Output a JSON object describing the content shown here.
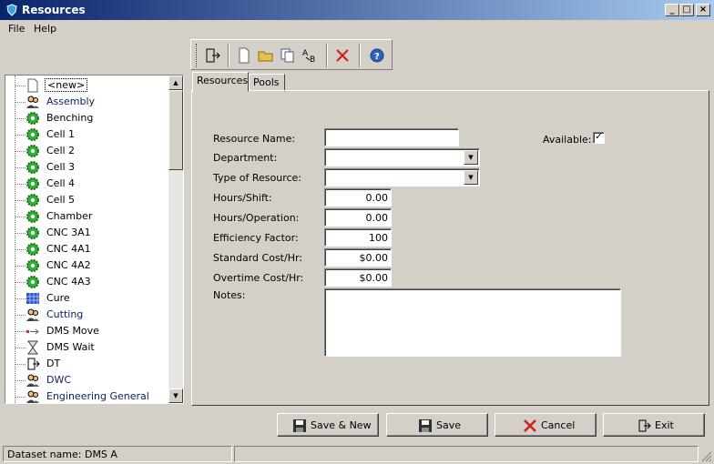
{
  "window": {
    "title": "Resources"
  },
  "menu": {
    "file": "File",
    "help": "Help"
  },
  "tree": {
    "items": [
      {
        "label": "<new>",
        "icon": "document-icon",
        "blue": false,
        "selected": true
      },
      {
        "label": "Assembly",
        "icon": "people-icon",
        "blue": true
      },
      {
        "label": "Benching",
        "icon": "gear-icon",
        "blue": false
      },
      {
        "label": "Cell 1",
        "icon": "gear-icon",
        "blue": false
      },
      {
        "label": "Cell 2",
        "icon": "gear-icon",
        "blue": false
      },
      {
        "label": "Cell 3",
        "icon": "gear-icon",
        "blue": false
      },
      {
        "label": "Cell 4",
        "icon": "gear-icon",
        "blue": false
      },
      {
        "label": "Cell 5",
        "icon": "gear-icon",
        "blue": false
      },
      {
        "label": "Chamber",
        "icon": "gear-icon",
        "blue": false
      },
      {
        "label": "CNC 3A1",
        "icon": "gear-icon",
        "blue": false
      },
      {
        "label": "CNC 4A1",
        "icon": "gear-icon",
        "blue": false
      },
      {
        "label": "CNC 4A2",
        "icon": "gear-icon",
        "blue": false
      },
      {
        "label": "CNC 4A3",
        "icon": "gear-icon",
        "blue": false
      },
      {
        "label": "Cure",
        "icon": "grid-icon",
        "blue": false
      },
      {
        "label": "Cutting",
        "icon": "people-icon",
        "blue": true
      },
      {
        "label": "DMS Move",
        "icon": "move-arrow-icon",
        "blue": false
      },
      {
        "label": "DMS Wait",
        "icon": "hourglass-icon",
        "blue": false
      },
      {
        "label": "DT",
        "icon": "door-exit-icon",
        "blue": false
      },
      {
        "label": "DWC",
        "icon": "people-icon",
        "blue": true
      },
      {
        "label": "Engineering General",
        "icon": "people-icon",
        "blue": true
      }
    ]
  },
  "tabs": [
    {
      "label": "Resources",
      "active": true
    },
    {
      "label": "Pools",
      "active": false
    }
  ],
  "form": {
    "resource_name": {
      "label": "Resource Name:",
      "value": ""
    },
    "available": {
      "label": "Available:",
      "checked": true,
      "mark": "✓"
    },
    "department": {
      "label": "Department:",
      "value": ""
    },
    "type_of_resource": {
      "label": "Type of Resource:",
      "value": ""
    },
    "hours_shift": {
      "label": "Hours/Shift:",
      "value": "0.00"
    },
    "hours_operation": {
      "label": "Hours/Operation:",
      "value": "0.00"
    },
    "efficiency_factor": {
      "label": "Efficiency Factor:",
      "value": "100"
    },
    "standard_cost": {
      "label": "Standard Cost/Hr:",
      "value": "$0.00"
    },
    "overtime_cost": {
      "label": "Overtime Cost/Hr:",
      "value": "$0.00"
    },
    "notes": {
      "label": "Notes:",
      "value": ""
    }
  },
  "buttons": {
    "save_new": "Save & New",
    "save": "Save",
    "cancel": "Cancel",
    "exit": "Exit"
  },
  "status": {
    "dataset": "Dataset name:  DMS A",
    "secondary": ""
  }
}
